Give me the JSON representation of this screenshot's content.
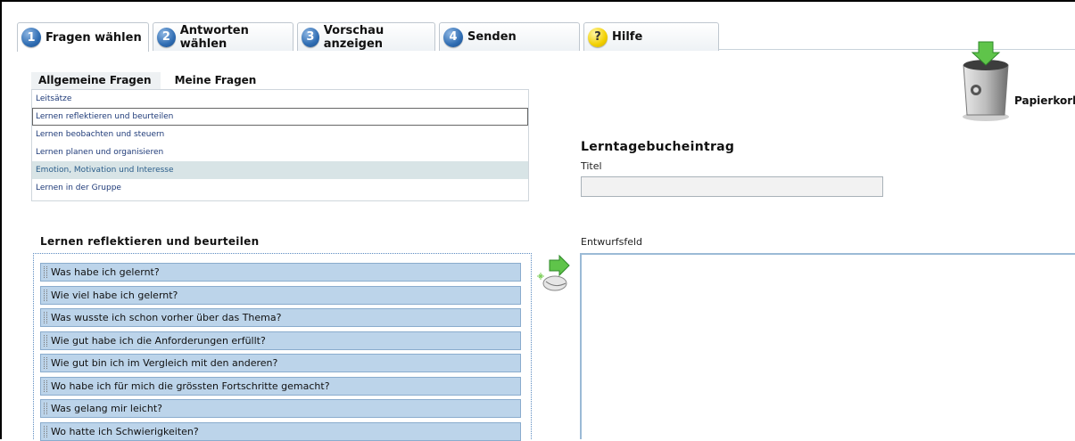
{
  "tabs": [
    {
      "num": "1",
      "label": "Fragen wählen",
      "active": true
    },
    {
      "num": "2",
      "label": "Antworten wählen"
    },
    {
      "num": "3",
      "label": "Vorschau anzeigen"
    },
    {
      "num": "4",
      "label": "Senden"
    },
    {
      "num": "?",
      "label": "Hilfe"
    }
  ],
  "trash": {
    "label": "Papierkorb"
  },
  "subtabs": [
    "Allgemeine Fragen",
    "Meine Fragen"
  ],
  "categories": [
    "Leitsätze",
    "Lernen reflektieren und beurteilen",
    "Lernen beobachten und steuern",
    "Lernen planen und organisieren",
    "Emotion, Motivation und Interesse",
    "Lernen in der Gruppe"
  ],
  "entry": {
    "title": "Lerntagebucheintrag",
    "titel_label": "Titel",
    "titel_value": ""
  },
  "draft": {
    "label": "Entwurfsfeld"
  },
  "questions": {
    "heading": "Lernen reflektieren und beurteilen",
    "items": [
      "Was habe ich gelernt?",
      "Wie viel habe ich gelernt?",
      "Was wusste ich schon vorher über das Thema?",
      "Wie gut habe ich die Anforderungen erfüllt?",
      "Wie gut bin ich im Vergleich mit den anderen?",
      "Wo habe ich für mich die grössten Fortschritte gemacht?",
      "Was gelang mir leicht?",
      "Wo hatte ich Schwierigkeiten?"
    ]
  }
}
